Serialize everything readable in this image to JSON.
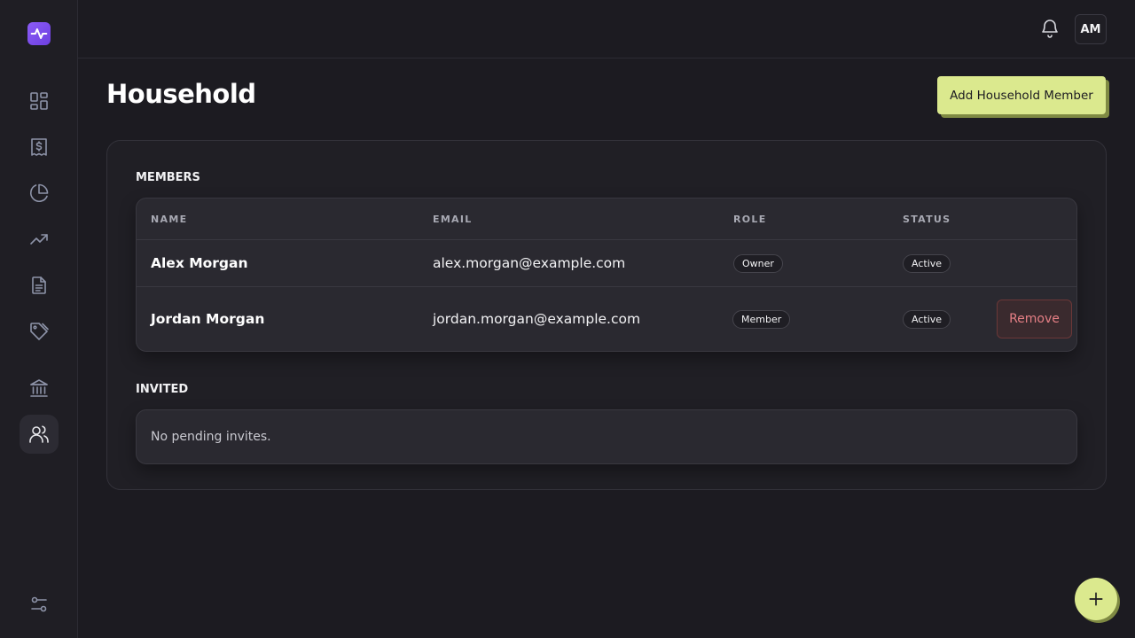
{
  "colors": {
    "accent": "#dbe98e",
    "brand": "#7c4dea",
    "background": "#1c1b21",
    "danger": "#e57f85"
  },
  "sidebar": {
    "logo_icon": "pulse-icon",
    "items": [
      {
        "name": "dashboard",
        "icon": "grid-icon",
        "active": false
      },
      {
        "name": "transactions",
        "icon": "receipt-icon",
        "active": false
      },
      {
        "name": "budgets",
        "icon": "pie-chart-icon",
        "active": false
      },
      {
        "name": "trends",
        "icon": "trending-up-icon",
        "active": false
      },
      {
        "name": "reports",
        "icon": "document-icon",
        "active": false
      },
      {
        "name": "tags",
        "icon": "tag-icon",
        "active": false
      },
      {
        "name": "accounts",
        "icon": "bank-icon",
        "active": false
      },
      {
        "name": "household",
        "icon": "users-icon",
        "active": true
      }
    ],
    "settings_icon": "sliders-icon"
  },
  "topbar": {
    "avatar_initials": "AM",
    "notification_icon": "bell-icon"
  },
  "page": {
    "title": "Household",
    "add_button_label": "Add Household Member"
  },
  "members": {
    "section_label": "MEMBERS",
    "columns": [
      "NAME",
      "EMAIL",
      "ROLE",
      "STATUS"
    ],
    "rows": [
      {
        "name": "Alex Morgan",
        "email": "alex.morgan@example.com",
        "role": "Owner",
        "status": "Active"
      },
      {
        "name": "Jordan Morgan",
        "email": "jordan.morgan@example.com",
        "role": "Member",
        "status": "Active",
        "action": "Remove"
      }
    ]
  },
  "invited": {
    "section_label": "INVITED",
    "empty_text": "No pending invites."
  },
  "fab": {
    "icon": "plus-icon"
  }
}
